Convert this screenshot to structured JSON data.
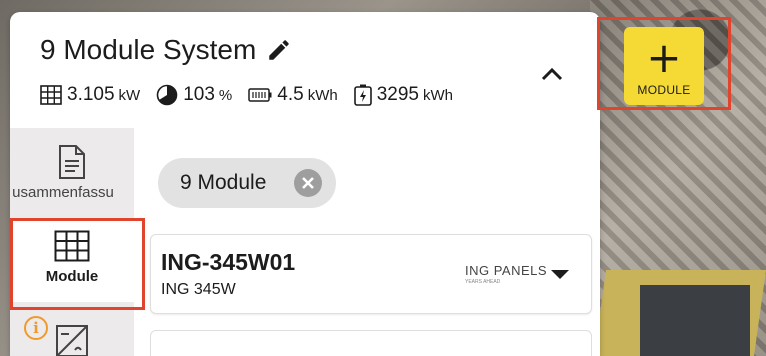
{
  "system": {
    "title": "9 Module System"
  },
  "stats": [
    {
      "icon": "grid-icon",
      "value": "3.105",
      "unit": "kW"
    },
    {
      "icon": "pie-chart-icon",
      "value": "103",
      "unit": "%"
    },
    {
      "icon": "battery-icon",
      "value": "4.5",
      "unit": "kWh"
    },
    {
      "icon": "energy-icon",
      "value": "3295",
      "unit": "kWh"
    }
  ],
  "sidebar": {
    "items": [
      {
        "label": "usammenfassu",
        "icon": "document-icon"
      },
      {
        "label": "Module",
        "icon": "grid-icon"
      }
    ]
  },
  "filter_chip": {
    "label": "9 Module"
  },
  "module_card": {
    "title": "ING-345W01",
    "subtitle": "ING 345W",
    "brand": "ING PANELS",
    "brand_tagline": "YEARS AHEAD"
  },
  "add_button": {
    "label": "MODULE",
    "symbol": "+"
  },
  "colors": {
    "accent_yellow": "#f5d935",
    "highlight_red": "#e1442c",
    "info_orange": "#f09a2c"
  }
}
